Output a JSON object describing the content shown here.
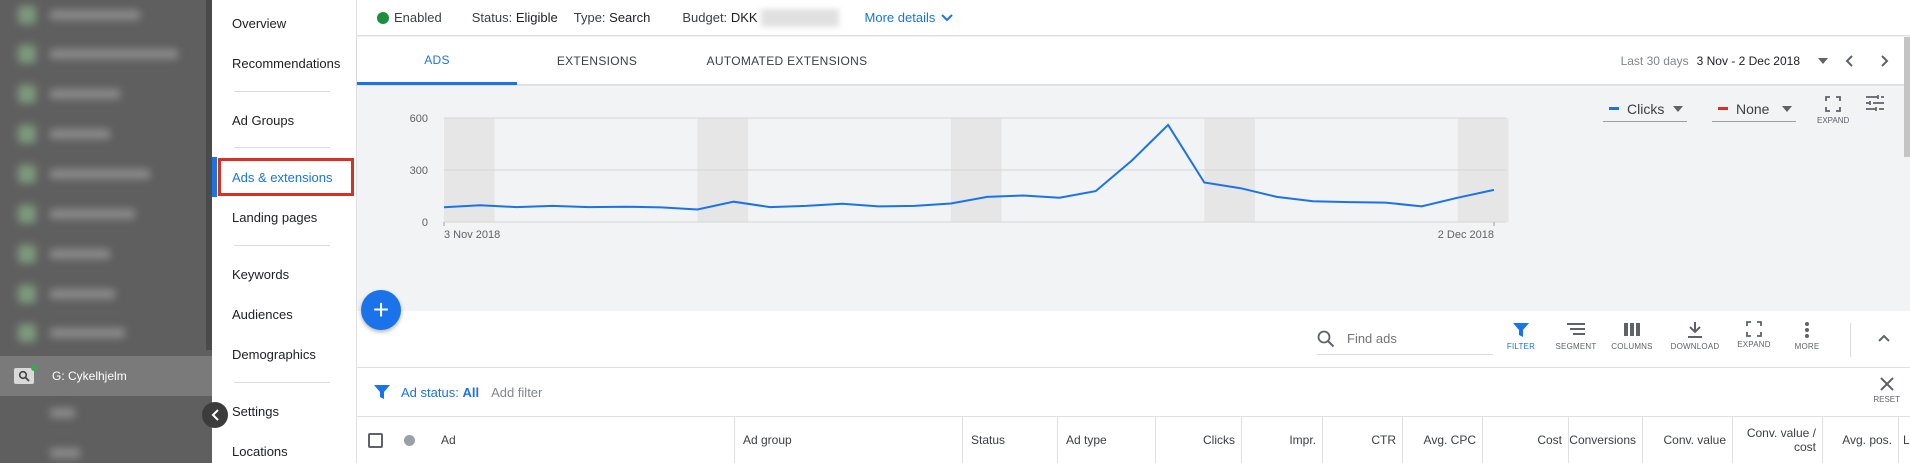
{
  "sidebar": {
    "campaign_label": "G: Cykelhjelm"
  },
  "nav": {
    "items": [
      "Overview",
      "Recommendations",
      "Ad Groups",
      "Ads & extensions",
      "Landing pages",
      "Keywords",
      "Audiences",
      "Demographics",
      "Settings",
      "Locations"
    ],
    "active": "Ads & extensions"
  },
  "status": {
    "enabled": "Enabled",
    "status_label": "Status:",
    "status_value": "Eligible",
    "type_label": "Type:",
    "type_value": "Search",
    "budget_label": "Budget:",
    "budget_value": "DKK",
    "more_details": "More details"
  },
  "tabs": [
    "ADS",
    "EXTENSIONS",
    "AUTOMATED EXTENSIONS"
  ],
  "date": {
    "label": "Last 30 days",
    "range": "3 Nov - 2 Dec 2018"
  },
  "chart_controls": {
    "metric1": "Clicks",
    "metric1_color": "#1a73e8",
    "metric2": "None",
    "metric2_color": "#d93025",
    "expand": "EXPAND"
  },
  "chart_data": {
    "type": "line",
    "series": [
      {
        "name": "Clicks",
        "color": "#1a73e8",
        "values": [
          85,
          97,
          86,
          93,
          86,
          88,
          84,
          72,
          117,
          86,
          93,
          105,
          90,
          93,
          107,
          145,
          153,
          140,
          178,
          355,
          560,
          228,
          195,
          145,
          120,
          115,
          112,
          90,
          140,
          185
        ]
      }
    ],
    "x_start_label": "3 Nov 2018",
    "x_end_label": "2 Dec 2018",
    "y_ticks": [
      "0",
      "300",
      "600"
    ],
    "ylim": [
      0,
      600
    ],
    "weekend_shading": true
  },
  "toolbar": {
    "search_placeholder": "Find ads",
    "buttons": [
      "FILTER",
      "SEGMENT",
      "COLUMNS",
      "DOWNLOAD",
      "EXPAND",
      "MORE"
    ]
  },
  "filter": {
    "status_label": "Ad status:",
    "status_value": "All",
    "add_filter": "Add filter",
    "reset": "RESET"
  },
  "table": {
    "columns": [
      "Ad",
      "Ad group",
      "Status",
      "Ad type",
      "Clicks",
      "Impr.",
      "CTR",
      "Avg. CPC",
      "Cost",
      "Conversions",
      "Conv. value",
      "Conv. value / cost",
      "Avg. pos.",
      "Lab"
    ]
  }
}
